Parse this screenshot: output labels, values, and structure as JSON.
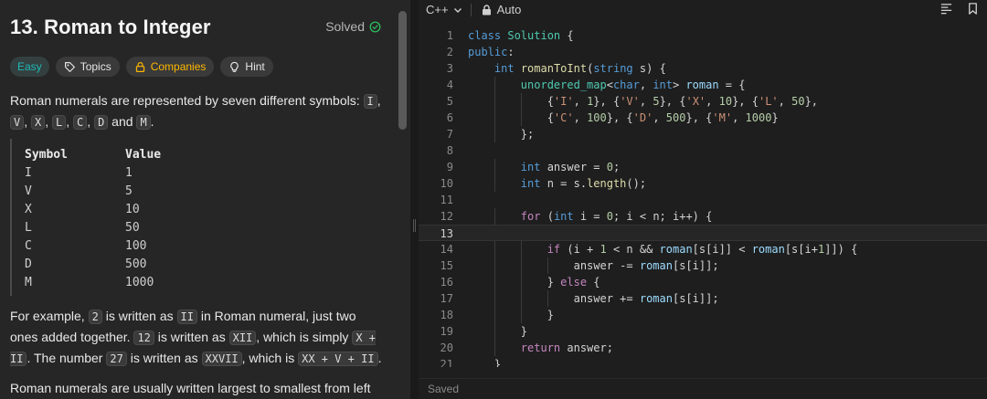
{
  "problem": {
    "title": "13. Roman to Integer",
    "status": "Solved",
    "tags": {
      "difficulty": "Easy",
      "topics": "Topics",
      "companies": "Companies",
      "hint": "Hint"
    },
    "intro": {
      "text1": "Roman numerals are represented by seven different symbols: ",
      "symbols": [
        "I",
        "V",
        "X",
        "L",
        "C",
        "D",
        "M"
      ],
      "sep": ", ",
      "and": " and ",
      "end": "."
    },
    "table": {
      "header_symbol": "Symbol",
      "header_value": "Value",
      "rows": [
        [
          "I",
          "1"
        ],
        [
          "V",
          "5"
        ],
        [
          "X",
          "10"
        ],
        [
          "L",
          "50"
        ],
        [
          "C",
          "100"
        ],
        [
          "D",
          "500"
        ],
        [
          "M",
          "1000"
        ]
      ]
    },
    "example": {
      "p1": "For example, ",
      "c1": "2",
      "p2": " is written as ",
      "c2": "II",
      "p3": " in Roman numeral, just two ones added together. ",
      "c3": "12",
      "p4": " is written as ",
      "c4": "XII",
      "p5": ", which is simply ",
      "c5": "X + II",
      "p6": ". The number ",
      "c6": "27",
      "p7": " is written as ",
      "c7": "XXVII",
      "p8": ", which is ",
      "c8": "XX + V + II",
      "p9": "."
    },
    "last_para": "Roman numerals are usually written largest to smallest from left"
  },
  "editor": {
    "language": "C++",
    "mode": "Auto",
    "status": "Saved",
    "active_line": 13,
    "lines": [
      {
        "n": "1",
        "code": "class Solution {"
      },
      {
        "n": "2",
        "code": "public:"
      },
      {
        "n": "3",
        "code": "    int romanToInt(string s) {"
      },
      {
        "n": "4",
        "code": "        unordered_map<char, int> roman = {"
      },
      {
        "n": "5",
        "code": "            {'I', 1}, {'V', 5}, {'X', 10}, {'L', 50},"
      },
      {
        "n": "6",
        "code": "            {'C', 100}, {'D', 500}, {'M', 1000}"
      },
      {
        "n": "7",
        "code": "        };"
      },
      {
        "n": "8",
        "code": ""
      },
      {
        "n": "9",
        "code": "        int answer = 0;"
      },
      {
        "n": "10",
        "code": "        int n = s.length();"
      },
      {
        "n": "11",
        "code": ""
      },
      {
        "n": "12",
        "code": "        for (int i = 0; i < n; i++) {"
      },
      {
        "n": "13",
        "code": ""
      },
      {
        "n": "14",
        "code": "            if (i + 1 < n && roman[s[i]] < roman[s[i+1]]) {"
      },
      {
        "n": "15",
        "code": "                answer -= roman[s[i]];"
      },
      {
        "n": "16",
        "code": "            } else {"
      },
      {
        "n": "17",
        "code": "                answer += roman[s[i]];"
      },
      {
        "n": "18",
        "code": "            }"
      },
      {
        "n": "19",
        "code": "        }"
      },
      {
        "n": "20",
        "code": "        return answer;"
      },
      {
        "n": "21",
        "code": "    }"
      }
    ]
  },
  "colors": {
    "easy": "#1cbaba",
    "companies": "#ffb800",
    "solved_check": "#2cbb5d"
  },
  "icons": [
    "check-circle-icon",
    "tag-icon",
    "lock-icon",
    "lightbulb-icon",
    "chevron-down-icon",
    "format-icon",
    "bookmark-icon"
  ]
}
